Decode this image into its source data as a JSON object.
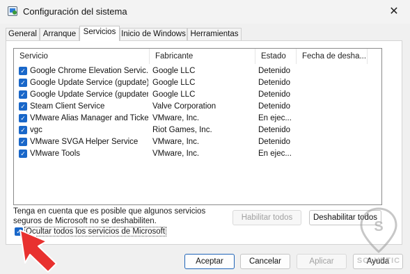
{
  "window": {
    "title": "Configuración del sistema",
    "close_glyph": "✕"
  },
  "tabs": [
    {
      "label": "General"
    },
    {
      "label": "Arranque"
    },
    {
      "label": "Servicios",
      "active": true
    },
    {
      "label": "Inicio de Windows"
    },
    {
      "label": "Herramientas"
    }
  ],
  "list": {
    "columns": [
      "Servicio",
      "Fabricante",
      "Estado",
      "Fecha de desha..."
    ],
    "rows": [
      {
        "checked": true,
        "service": "Google Chrome Elevation Servic...",
        "vendor": "Google LLC",
        "status": "Detenido"
      },
      {
        "checked": true,
        "service": "Google Update Service (gupdate)",
        "vendor": "Google LLC",
        "status": "Detenido"
      },
      {
        "checked": true,
        "service": "Google Update Service (gupdatem)",
        "vendor": "Google LLC",
        "status": "Detenido"
      },
      {
        "checked": true,
        "service": "Steam Client Service",
        "vendor": "Valve Corporation",
        "status": "Detenido"
      },
      {
        "checked": true,
        "service": "VMware Alias Manager and Ticke...",
        "vendor": "VMware, Inc.",
        "status": "En ejec..."
      },
      {
        "checked": true,
        "service": "vgc",
        "vendor": "Riot Games, Inc.",
        "status": "Detenido"
      },
      {
        "checked": true,
        "service": "VMware SVGA Helper Service",
        "vendor": "VMware, Inc.",
        "status": "Detenido"
      },
      {
        "checked": true,
        "service": "VMware Tools",
        "vendor": "VMware, Inc.",
        "status": "En ejec..."
      }
    ]
  },
  "note": "Tenga en cuenta que es posible que algunos servicios seguros de Microsoft no se deshabiliten.",
  "buttons": {
    "enable_all": "Habilitar todos",
    "disable_all": "Deshabilitar todos",
    "accept": "Aceptar",
    "cancel": "Cancelar",
    "apply": "Aplicar",
    "help": "Ayuda"
  },
  "hide_ms": {
    "label": "Ocultar todos los servicios de Microsoft",
    "checked": true
  },
  "watermark": {
    "text": "SOLVETIC",
    "icon": "pin-logo"
  },
  "annotation": {
    "icon": "red-arrow-icon",
    "color": "#e8312f"
  },
  "colors": {
    "accent": "#1967c9"
  }
}
